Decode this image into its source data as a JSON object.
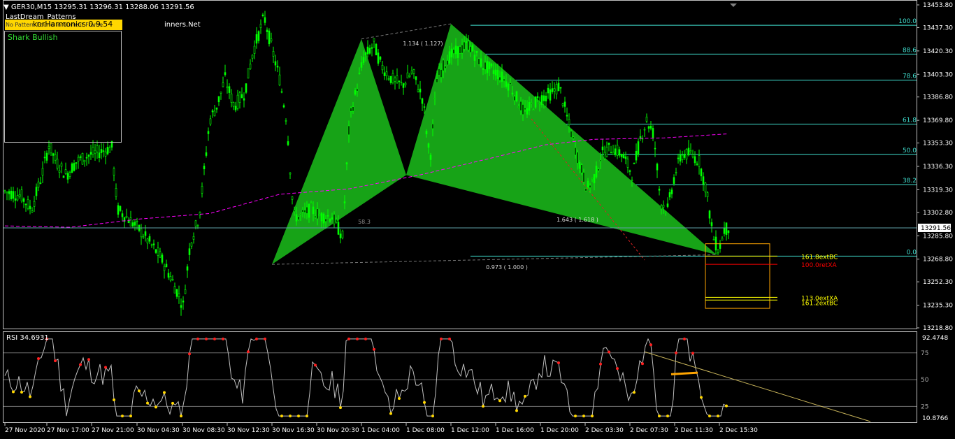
{
  "header": {
    "symbol_line": "GER30,M15  13295.31 13296.31 13288.06 13291.56",
    "indicator_name": "LastDream_Patterns",
    "toolbar_text_small": "No Pattern Found In Current Frame",
    "toolbar_title": "korHarmonics 0.9.54",
    "toolbar_site": "inners.Net",
    "toolbar_icons": [
      "grid-icon",
      "arrows-icon",
      "power-icon"
    ],
    "menu_icon": "triangle-down-icon"
  },
  "pattern_panel": {
    "label": "Shark Bullish"
  },
  "colors": {
    "background": "#000000",
    "candle": "#00ff00",
    "pattern_fill": "#17a317",
    "fib": "#40e0d0",
    "ma": "#ff00ff",
    "prz_box": "#ffa500",
    "prz_yellow": "#ffff00",
    "prz_red": "#ff0000",
    "rsi_line": "#c0c0c0",
    "trendline": "#c8b45a"
  },
  "chart_data": {
    "type": "candlestick",
    "symbol": "GER30",
    "timeframe": "M15",
    "ohlc_current": {
      "open": 13295.31,
      "high": 13296.31,
      "low": 13288.06,
      "close": 13291.56
    },
    "current_price_label": "13291.56",
    "y_axis_ticks": [
      "13453.80",
      "13437.30",
      "13420.30",
      "13403.30",
      "13386.80",
      "13369.80",
      "13353.30",
      "13336.30",
      "13319.30",
      "13302.80",
      "13285.80",
      "13268.80",
      "13252.30",
      "13235.30",
      "13218.80"
    ],
    "x_axis_ticks": [
      "27 Nov 2020",
      "27 Nov 17:00",
      "27 Nov 21:00",
      "30 Nov 04:30",
      "30 Nov 08:30",
      "30 Nov 12:30",
      "30 Nov 16:30",
      "30 Nov 20:30",
      "1 Dec 04:00",
      "1 Dec 08:00",
      "1 Dec 12:00",
      "1 Dec 16:00",
      "1 Dec 20:00",
      "2 Dec 03:30",
      "2 Dec 07:30",
      "2 Dec 11:30",
      "2 Dec 15:30"
    ],
    "fib_levels": [
      {
        "label": "100.0",
        "value": 13439
      },
      {
        "label": "88.6",
        "value": 13418
      },
      {
        "label": "78.6",
        "value": 13399
      },
      {
        "label": "61.8",
        "value": 13367
      },
      {
        "label": "50.0",
        "value": 13345
      },
      {
        "label": "38.2",
        "value": 13323
      },
      {
        "label": "0.0",
        "value": 13271
      }
    ],
    "pattern": {
      "name": "Shark Bullish",
      "ratios": [
        "1.134 ( 1.127)",
        "1.643 ( 1.618 )",
        "0.973 ( 1.000 )",
        "58.3"
      ],
      "points": {
        "X": {
          "time": "30 Nov 16:30",
          "price": 13265
        },
        "A": {
          "time": "1 Dec 04:00",
          "price": 13429
        },
        "B": {
          "time": "1 Dec 08:00",
          "price": 13330
        },
        "C": {
          "time": "1 Dec 12:00",
          "price": 13440
        },
        "D": {
          "time": "2 Dec 14:30",
          "price": 13272
        }
      }
    },
    "prz_labels": [
      {
        "label": "161.8extBC",
        "value": 13271,
        "color": "#ffff00"
      },
      {
        "label": "100.0retXA",
        "value": 13265,
        "color": "#ff0000"
      },
      {
        "label": "113.0extXA",
        "value": 13241,
        "color": "#ffff00"
      },
      {
        "label": "161.2extBC",
        "value": 13239,
        "color": "#ffff00"
      }
    ],
    "ylim": [
      13212,
      13460
    ],
    "rsi": {
      "title": "RSI 34.6931",
      "value": 34.6931,
      "axis_top_label": "92.4748",
      "axis_bottom_label": "10.8766",
      "levels": [
        75,
        50,
        25
      ],
      "level_labels": [
        "75",
        "50",
        "25"
      ],
      "ylim": [
        10.8766,
        92.4748
      ]
    }
  }
}
